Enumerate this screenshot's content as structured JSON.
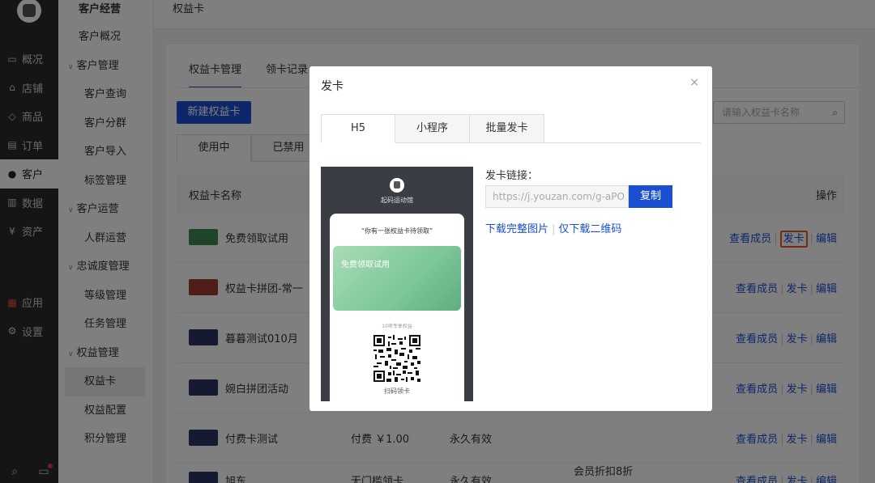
{
  "nav": {
    "items": [
      {
        "label": "概况",
        "icon": "monitor-icon"
      },
      {
        "label": "店铺",
        "icon": "store-icon"
      },
      {
        "label": "商品",
        "icon": "tag-icon"
      },
      {
        "label": "订单",
        "icon": "order-icon"
      },
      {
        "label": "客户",
        "icon": "user-icon"
      },
      {
        "label": "数据",
        "icon": "chart-icon"
      },
      {
        "label": "资产",
        "icon": "yen-icon"
      }
    ],
    "apps_label": "应用",
    "settings_label": "设置"
  },
  "sub": {
    "title": "客户经营",
    "items": [
      {
        "label": "客户概况",
        "level": "l1"
      },
      {
        "label": "客户管理",
        "level": "grp"
      },
      {
        "label": "客户查询",
        "level": "l2"
      },
      {
        "label": "客户分群",
        "level": "l2"
      },
      {
        "label": "客户导入",
        "level": "l2"
      },
      {
        "label": "标签管理",
        "level": "l2"
      },
      {
        "label": "客户运营",
        "level": "grp"
      },
      {
        "label": "人群运营",
        "level": "l2"
      },
      {
        "label": "忠诚度管理",
        "level": "grp"
      },
      {
        "label": "等级管理",
        "level": "l2"
      },
      {
        "label": "任务管理",
        "level": "l2"
      },
      {
        "label": "权益管理",
        "level": "grp"
      },
      {
        "label": "权益卡",
        "level": "l2"
      },
      {
        "label": "权益配置",
        "level": "l2"
      },
      {
        "label": "积分管理",
        "level": "l2"
      }
    ]
  },
  "header": {
    "title": "权益卡"
  },
  "main": {
    "tabs": [
      "权益卡管理",
      "领卡记录"
    ],
    "new_button": "新建权益卡",
    "search_placeholder": "请输入权益卡名称",
    "segments": [
      "使用中",
      "已禁用"
    ],
    "col_name": "权益卡名称",
    "col_ops": "操作",
    "op_view": "查看成员",
    "op_issue": "发卡",
    "op_edit": "编辑",
    "rows": [
      {
        "name": "免费领取试用",
        "color": "#3c8a4e",
        "type": "",
        "valid": "",
        "benefit": ""
      },
      {
        "name": "权益卡拼团-常一",
        "color": "#a33a30",
        "type": "",
        "valid": "",
        "benefit": ""
      },
      {
        "name": "暮暮测试010月",
        "color": "#2c3560",
        "type": "",
        "valid": "",
        "benefit": ""
      },
      {
        "name": "婉白拼团活动",
        "color": "#2c3560",
        "type": "",
        "valid": "",
        "benefit": ""
      },
      {
        "name": "付费卡测试",
        "color": "#2c3560",
        "type": "付费 ￥1.00",
        "valid": "永久有效",
        "benefit": ""
      },
      {
        "name": "旭东",
        "color": "#2c3560",
        "type": "无门槛领卡",
        "valid": "永久有效",
        "benefit": "会员折扣8折"
      }
    ]
  },
  "modal": {
    "title": "发卡",
    "close": "×",
    "tabs": [
      "H5",
      "小程序",
      "批量发卡"
    ],
    "phone": {
      "shop_name": "起码运动馆",
      "invite": "“你有一张权益卡待领取”",
      "card_name": "免费领取试用",
      "count": "10项专享权益",
      "scan": "扫码领卡"
    },
    "link_label": "发卡链接：",
    "link_value": "https://j.youzan.com/g-aPO",
    "copy": "复制",
    "download_full": "下载完整图片",
    "download_qr": "仅下载二维码"
  }
}
